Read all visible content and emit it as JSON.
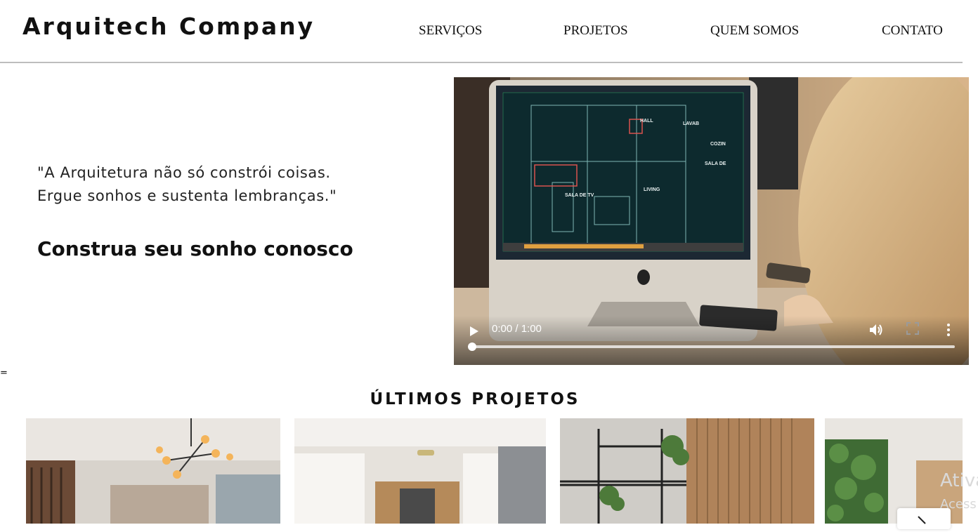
{
  "header": {
    "logo": "Arquitech Company",
    "nav": [
      "SERVIÇOS",
      "PROJETOS",
      "QUEM SOMOS",
      "CONTATO"
    ]
  },
  "hero": {
    "quote_line1": "\"A Arquitetura não só constrói coisas.",
    "quote_line2": "Ergue sonhos e sustenta lembranças.\"",
    "slogan": "Construa seu sonho conosco",
    "stray_mark": "="
  },
  "video": {
    "time": "0:00 / 1:00",
    "progress": 0,
    "screen_labels": [
      "HALL",
      "LAVAB",
      "COZIN",
      "SALA DE",
      "SALA DE TV",
      "LIVING"
    ],
    "icons": [
      "play-icon",
      "volume-icon",
      "fullscreen-icon",
      "more-options-icon"
    ]
  },
  "projects": {
    "title": "ÚLTIMOS PROJETOS"
  },
  "watermark": {
    "line1": "Ativa",
    "line2": "Acess"
  }
}
